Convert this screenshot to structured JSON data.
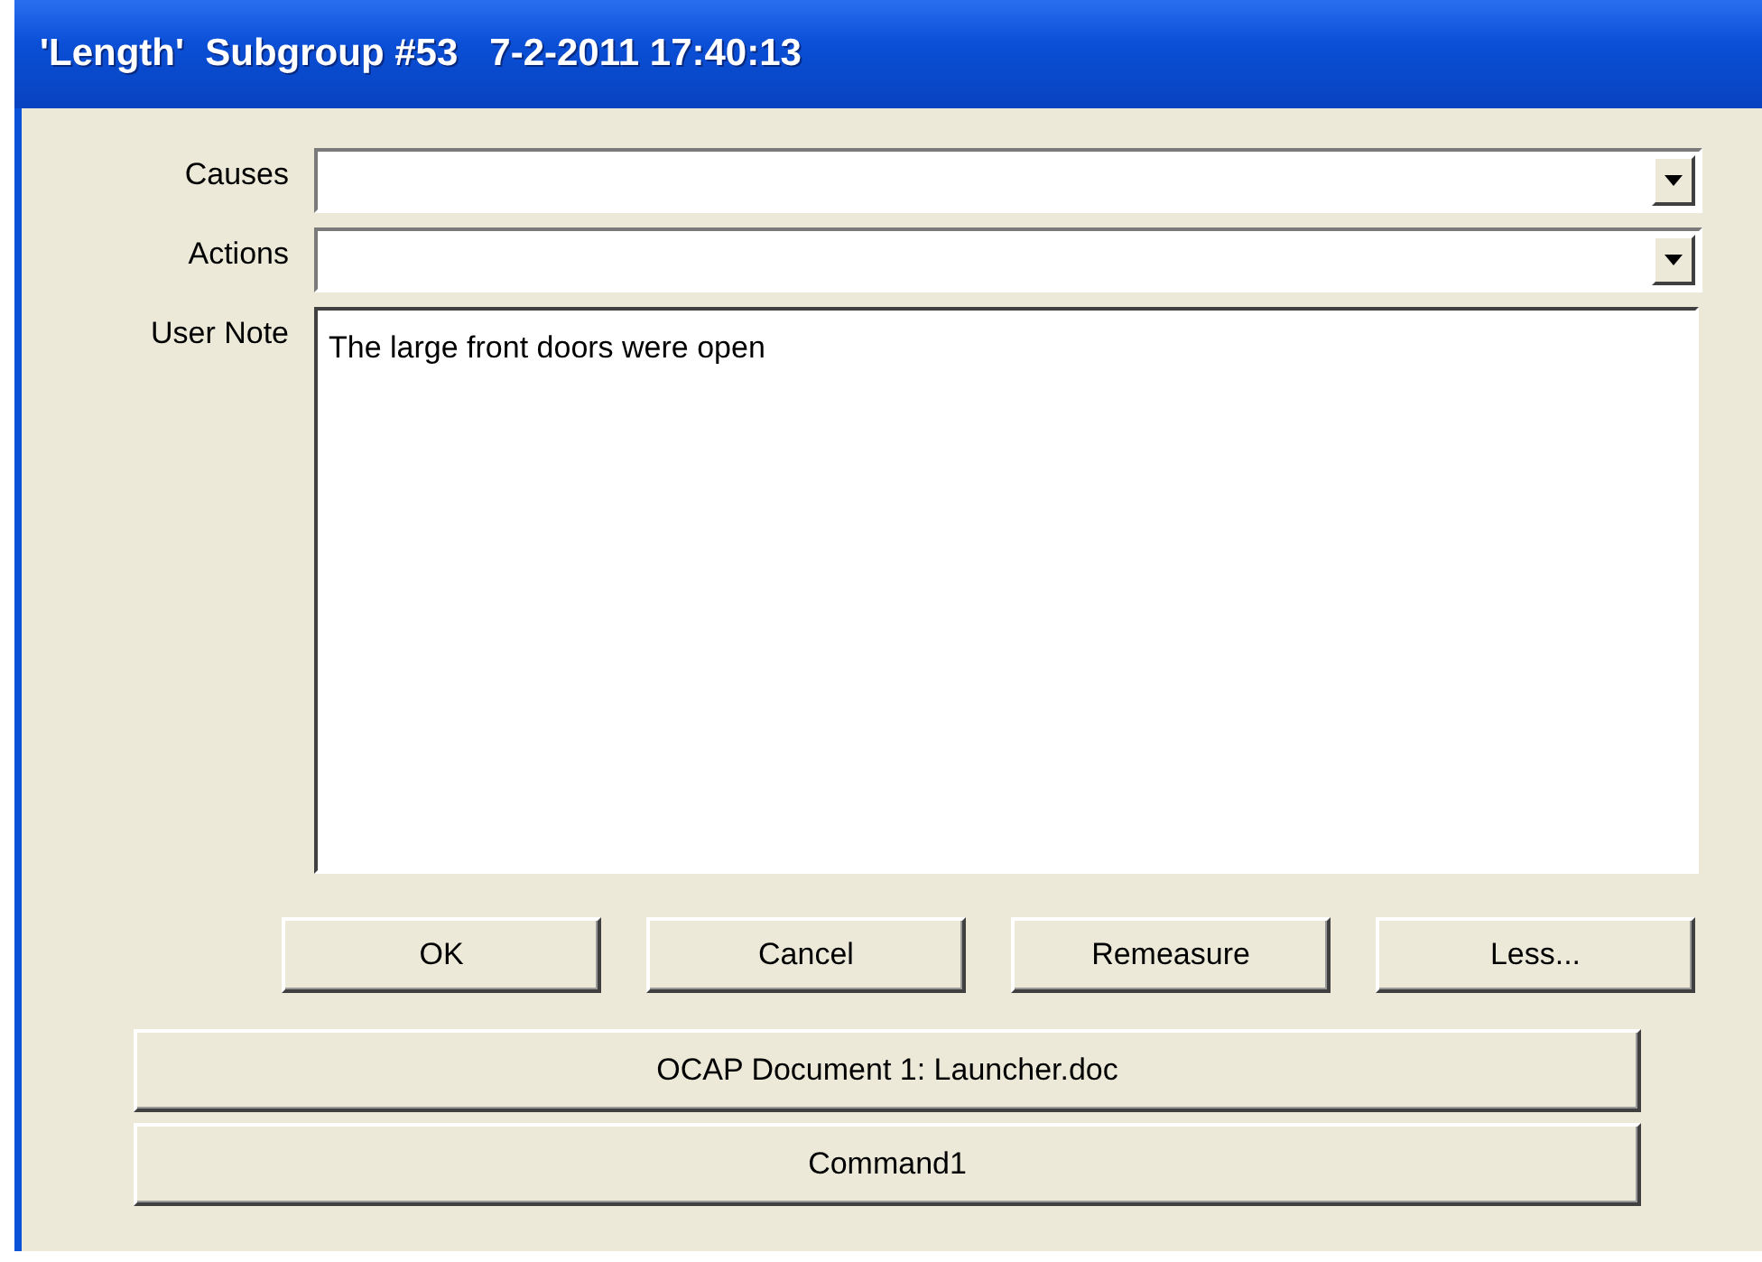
{
  "window": {
    "title": "'Length'  Subgroup #53   7-2-2011 17:40:13"
  },
  "fields": [
    {
      "label": "Causes",
      "kind": "combo"
    },
    {
      "label": "Actions",
      "kind": "combo"
    },
    {
      "label": "User Note",
      "kind": "memo",
      "value": "The large front doors were open"
    }
  ],
  "buttons": [
    "OK",
    "Cancel",
    "Remeasure",
    "Less..."
  ],
  "wide_buttons": [
    "OCAP Document 1: Launcher.doc",
    "Command1"
  ]
}
